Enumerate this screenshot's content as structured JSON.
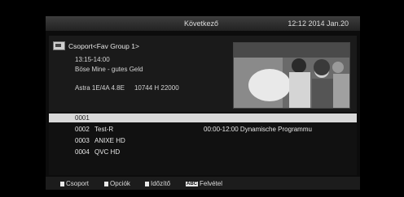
{
  "header": {
    "title": "Következő",
    "clock": "12:12 2014 Jan.20"
  },
  "info": {
    "group_label": "Csoport<Fav Group 1>",
    "event_time": "13:15-14:00",
    "event_title": "Böse Mine - gutes Geld",
    "satellite": "Astra 1E/4A 4.8E",
    "frequency": "10744 H 22000",
    "group_icon": "tv-icon"
  },
  "channels": [
    {
      "number": "0001",
      "name": "",
      "epg": ""
    },
    {
      "number": "0002",
      "name": "Test-R",
      "epg": "00:00-12:00  Dynamische Programmu"
    },
    {
      "number": "0003",
      "name": "ANIXE HD",
      "epg": ""
    },
    {
      "number": "0004",
      "name": "QVC HD",
      "epg": ""
    }
  ],
  "footer": {
    "red": "Csoport",
    "green": "Opciók",
    "yellow": "Időzítő",
    "abc_icon": "ABC",
    "blue": "Felvétel"
  }
}
